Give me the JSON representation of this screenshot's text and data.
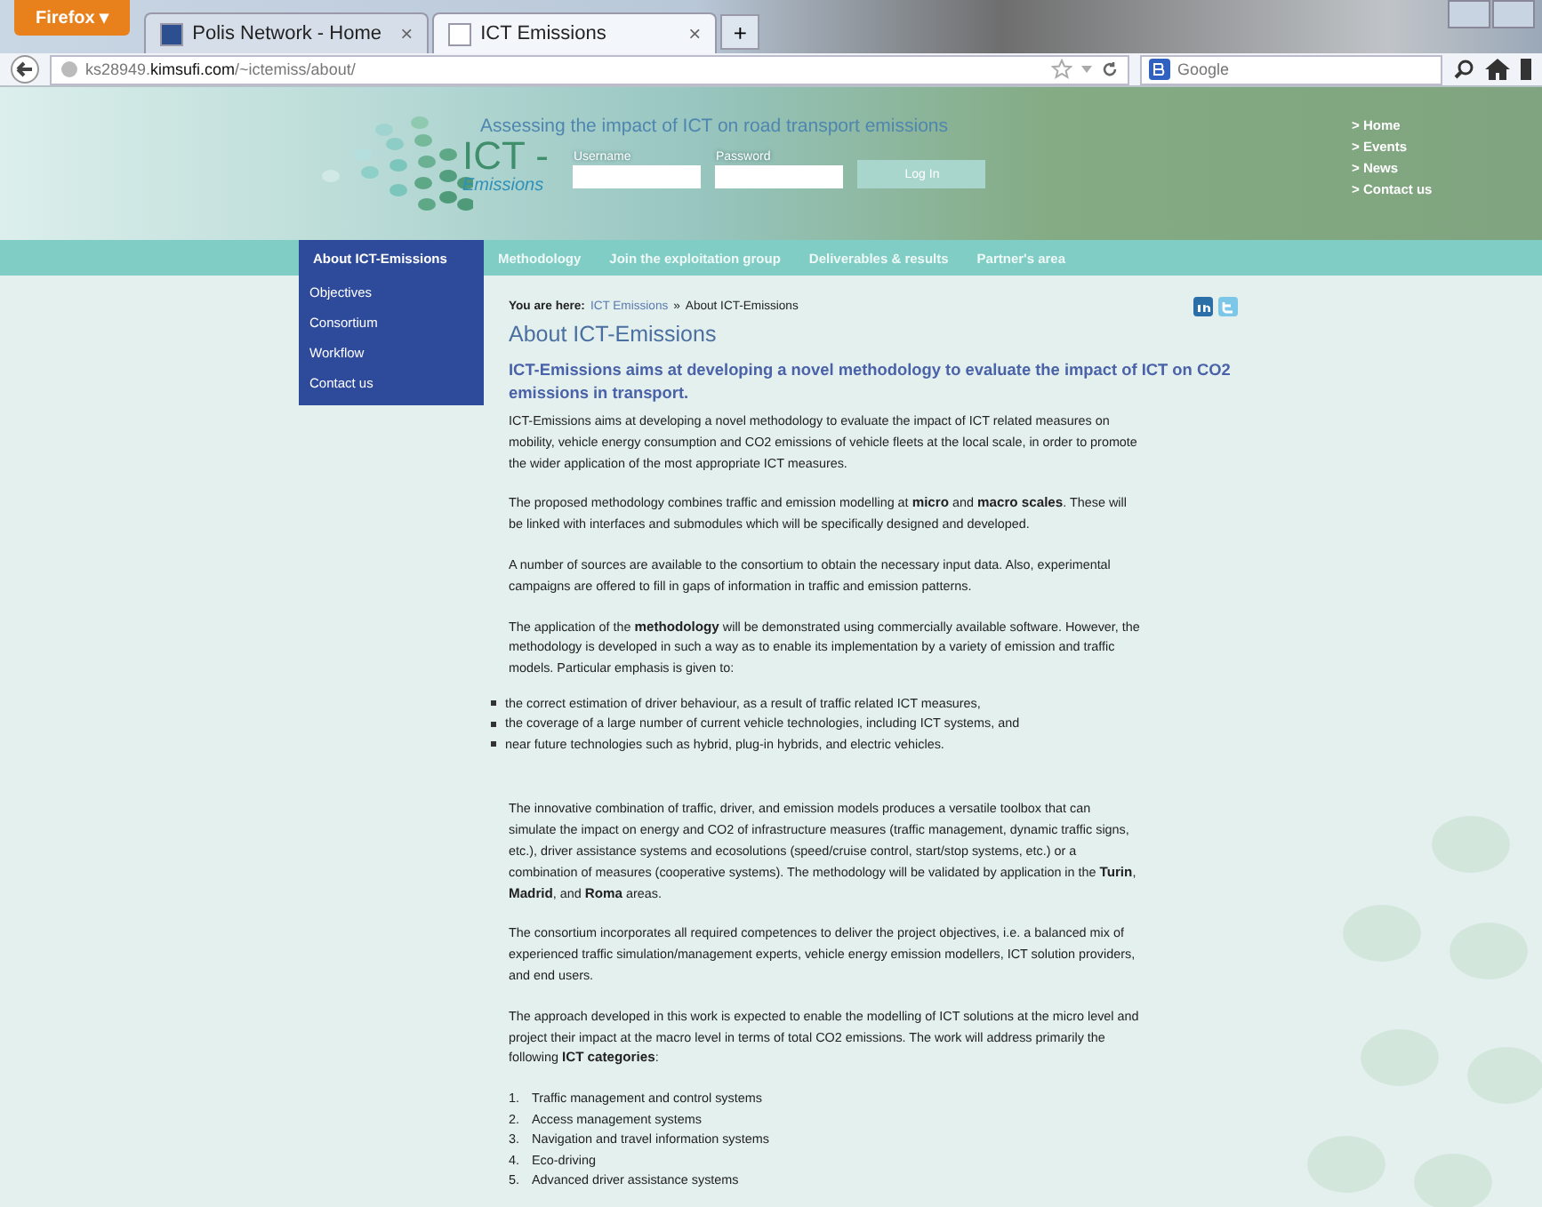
{
  "browser": {
    "menu_button": "Firefox",
    "menu_caret": "▾",
    "tab_close": "×",
    "tabs": [
      {
        "title": "Polis Network - Home",
        "selected": false
      },
      {
        "title": "ICT Emissions",
        "selected": true
      }
    ],
    "new_tab": "+",
    "url": "ks28949.**kimsufi.com**/~ictemiss/about/",
    "search_placeholder": "Google"
  },
  "header": {
    "tagline": "Assessing the impact of ICT on road transport emissions",
    "logo_title": "ICT -",
    "logo_subtitle": "Emissions",
    "login": {
      "username_label": "Username",
      "password_label": "Password",
      "button": "Log In"
    },
    "top_links": [
      "> Home",
      "> Events",
      "> News",
      "> Contact us"
    ]
  },
  "nav": [
    {
      "label": "About ICT-Emissions",
      "selected": true
    },
    {
      "label": "Methodology",
      "selected": false
    },
    {
      "label": "Join the exploitation group",
      "selected": false
    },
    {
      "label": "Deliverables & results",
      "selected": false
    },
    {
      "label": "Partner's area",
      "selected": false
    }
  ],
  "sidebar": {
    "items": [
      "Objectives",
      "Consortium",
      "Workflow",
      "Contact us"
    ]
  },
  "breadcrumb": {
    "prefix": "You are here:",
    "link": "ICT Emissions",
    "separator": "»",
    "current": "About ICT-Emissions"
  },
  "title": "About ICT-Emissions",
  "lead": "ICT-Emissions aims at developing a novel methodology to evaluate the impact of ICT on CO2 emissions in transport.",
  "blocks": [
    {
      "kind": "paragraph",
      "text": "ICT-Emissions aims at developing a novel methodology to evaluate the impact of ICT related measures on mobility, vehicle energy consumption and CO2 emissions of vehicle fleets at the local scale, in order to promote the wider application of the most appropriate ICT measures."
    },
    {
      "kind": "paragraph",
      "text": "The proposed methodology combines traffic and emission modelling at **micro** and **macro scales**. These will be linked with interfaces and submodules which will be specifically designed and developed."
    },
    {
      "kind": "paragraph",
      "text": "A number of sources are available to the consortium to obtain the necessary input data. Also, experimental campaigns are offered to fill in gaps of information in traffic and emission patterns."
    },
    {
      "kind": "paragraph",
      "text": "The application of the **methodology** will be demonstrated using commercially available software. However, the methodology is developed in such a way as to enable its implementation by a variety of emission and traffic models. Particular emphasis is given to:"
    },
    {
      "kind": "bullets",
      "items": [
        "the correct estimation of driver behaviour, as a result of traffic related ICT measures,",
        "the coverage of a large number of current vehicle technologies, including ICT systems, and",
        "near future technologies such as hybrid, plug-in hybrids, and electric vehicles."
      ]
    },
    {
      "kind": "paragraph",
      "text": "The innovative combination of traffic, driver, and emission models produces a versatile toolbox that can simulate the impact on energy and CO2  of infrastructure measures (traffic management, dynamic traffic signs, etc.), driver assistance systems and ecosolutions (speed/cruise control, start/stop systems, etc.) or a combination of measures (cooperative systems). The methodology will be validated by application in the **Turin**, **Madrid**, and **Roma** areas."
    },
    {
      "kind": "paragraph",
      "text": "The consortium incorporates all required competences to deliver the project objectives, i.e. a balanced mix of experienced traffic simulation/management experts, vehicle energy emission modellers, ICT solution providers, and end users."
    },
    {
      "kind": "paragraph",
      "text": "The approach developed in this work is expected to enable the modelling of ICT solutions at the micro level and project their impact at the macro level in terms of total CO2  emissions. The work will address primarily the following **ICT categories**:"
    },
    {
      "kind": "numbered",
      "items": [
        {
          "number": "1.",
          "text": "Traffic management and control systems"
        },
        {
          "number": "2.",
          "text": "Access management systems"
        },
        {
          "number": "3.",
          "text": "Navigation and travel information systems"
        },
        {
          "number": "4.",
          "text": "Eco-driving"
        },
        {
          "number": "5.",
          "text": "Advanced driver assistance systems"
        }
      ]
    }
  ]
}
